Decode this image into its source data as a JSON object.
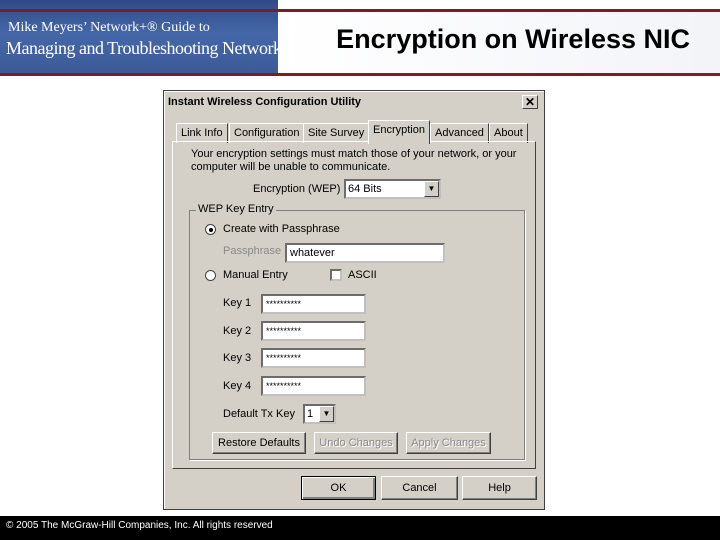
{
  "slide": {
    "logo_line1": "Mike Meyers’ Network+® Guide to",
    "logo_line2": "Managing and Troubleshooting Networks",
    "title": "Encryption on Wireless NIC",
    "copyright": "© 2005 The McGraw-Hill Companies, Inc. All rights reserved"
  },
  "dialog": {
    "title": "Instant Wireless Configuration Utility",
    "close_label": "✕",
    "tabs": [
      {
        "label": "Link Info",
        "active": false
      },
      {
        "label": "Configuration",
        "active": false
      },
      {
        "label": "Site Survey",
        "active": false
      },
      {
        "label": "Encryption",
        "active": true
      },
      {
        "label": "Advanced",
        "active": false
      },
      {
        "label": "About",
        "active": false
      }
    ],
    "info_text": "Your encryption settings must match those of your network, or your computer will be unable to communicate.",
    "encryption": {
      "label": "Encryption (WEP)",
      "value": "64 Bits"
    },
    "wep_group": {
      "legend": "WEP Key Entry",
      "passphrase_option": {
        "label": "Create with Passphrase",
        "checked": true
      },
      "passphrase": {
        "label": "Passphrase",
        "value": "whatever"
      },
      "manual_option": {
        "label": "Manual Entry",
        "checked": false
      },
      "ascii": {
        "label": "ASCII",
        "checked": false
      },
      "keys": [
        {
          "label": "Key 1",
          "value": "**********"
        },
        {
          "label": "Key 2",
          "value": "**********"
        },
        {
          "label": "Key 3",
          "value": "**********"
        },
        {
          "label": "Key 4",
          "value": "**********"
        }
      ],
      "default_tx_key": {
        "label": "Default Tx Key",
        "value": "1"
      },
      "restore_label": "Restore Defaults",
      "undo_label": "Undo Changes",
      "apply_label": "Apply Changes"
    },
    "buttons": {
      "ok": "OK",
      "cancel": "Cancel",
      "help": "Help"
    }
  },
  "colors": {
    "accent_rule": "#7d1a2c",
    "logo_background": "#3b5996",
    "dialog_face": "#d4d0c8"
  }
}
